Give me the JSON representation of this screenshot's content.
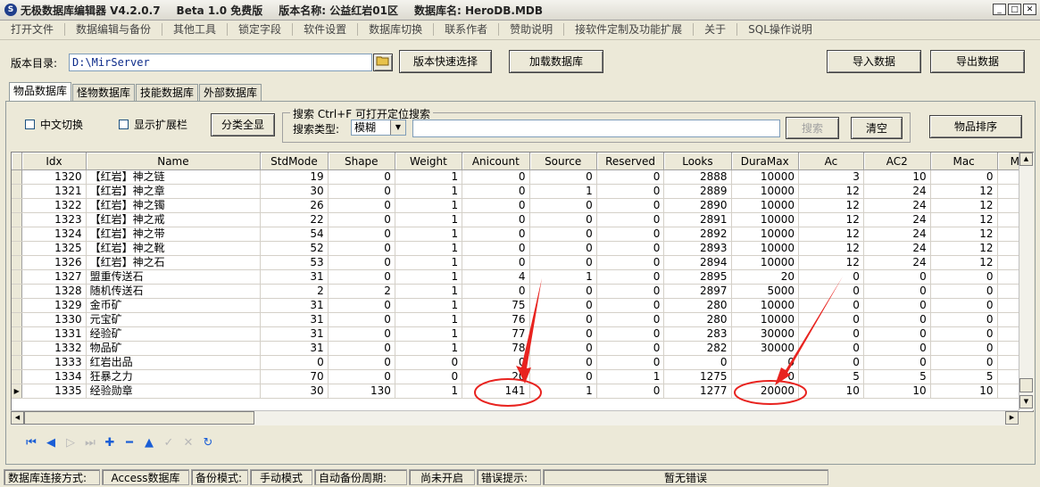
{
  "titlebar": {
    "app_name": "无极数据库编辑器 V4.2.0.7",
    "edition": "Beta 1.0 免费版",
    "version_name": "版本名称: 公益红岩01区",
    "db_name": "数据库名: HeroDB.MDB"
  },
  "menu": [
    "打开文件",
    "数据编辑与备份",
    "其他工具",
    "锁定字段",
    "软件设置",
    "数据库切换",
    "联系作者",
    "赞助说明",
    "接软件定制及功能扩展",
    "关于",
    "SQL操作说明"
  ],
  "toolbar": {
    "dir_label": "版本目录:",
    "dir_value": "D:\\MirServer",
    "quick_select": "版本快速选择",
    "load_db": "加载数据库",
    "import": "导入数据",
    "export": "导出数据"
  },
  "tabs": [
    "物品数据库",
    "怪物数据库",
    "技能数据库",
    "外部数据库"
  ],
  "filters": {
    "chinese_toggle": "中文切换",
    "show_extension": "显示扩展栏",
    "show_all_categories": "分类全显",
    "search_group_title": "搜索  Ctrl+F 可打开定位搜索",
    "search_type_label": "搜索类型:",
    "search_type_value": "模糊",
    "search_button": "搜索",
    "clear_button": "清空",
    "sort_button": "物品排序"
  },
  "grid": {
    "columns": [
      "Idx",
      "Name",
      "StdMode",
      "Shape",
      "Weight",
      "Anicount",
      "Source",
      "Reserved",
      "Looks",
      "DuraMax",
      "Ac",
      "AC2",
      "Mac",
      "M"
    ],
    "rows": [
      [
        "1320",
        "【红岩】神之链",
        "19",
        "0",
        "1",
        "0",
        "0",
        "0",
        "2888",
        "10000",
        "3",
        "10",
        "0"
      ],
      [
        "1321",
        "【红岩】神之章",
        "30",
        "0",
        "1",
        "0",
        "1",
        "0",
        "2889",
        "10000",
        "12",
        "24",
        "12"
      ],
      [
        "1322",
        "【红岩】神之镯",
        "26",
        "0",
        "1",
        "0",
        "0",
        "0",
        "2890",
        "10000",
        "12",
        "24",
        "12"
      ],
      [
        "1323",
        "【红岩】神之戒",
        "22",
        "0",
        "1",
        "0",
        "0",
        "0",
        "2891",
        "10000",
        "12",
        "24",
        "12"
      ],
      [
        "1324",
        "【红岩】神之带",
        "54",
        "0",
        "1",
        "0",
        "0",
        "0",
        "2892",
        "10000",
        "12",
        "24",
        "12"
      ],
      [
        "1325",
        "【红岩】神之靴",
        "52",
        "0",
        "1",
        "0",
        "0",
        "0",
        "2893",
        "10000",
        "12",
        "24",
        "12"
      ],
      [
        "1326",
        "【红岩】神之石",
        "53",
        "0",
        "1",
        "0",
        "0",
        "0",
        "2894",
        "10000",
        "12",
        "24",
        "12"
      ],
      [
        "1327",
        "盟重传送石",
        "31",
        "0",
        "1",
        "4",
        "1",
        "0",
        "2895",
        "20",
        "0",
        "0",
        "0"
      ],
      [
        "1328",
        "随机传送石",
        "2",
        "2",
        "1",
        "0",
        "0",
        "0",
        "2897",
        "5000",
        "0",
        "0",
        "0"
      ],
      [
        "1329",
        "金币矿",
        "31",
        "0",
        "1",
        "75",
        "0",
        "0",
        "280",
        "10000",
        "0",
        "0",
        "0"
      ],
      [
        "1330",
        "元宝矿",
        "31",
        "0",
        "1",
        "76",
        "0",
        "0",
        "280",
        "10000",
        "0",
        "0",
        "0"
      ],
      [
        "1331",
        "经验矿",
        "31",
        "0",
        "1",
        "77",
        "0",
        "0",
        "283",
        "30000",
        "0",
        "0",
        "0"
      ],
      [
        "1332",
        "物品矿",
        "31",
        "0",
        "1",
        "78",
        "0",
        "0",
        "282",
        "30000",
        "0",
        "0",
        "0"
      ],
      [
        "1333",
        "红岩出品",
        "0",
        "0",
        "0",
        "0",
        "0",
        "0",
        "0",
        "0",
        "0",
        "0",
        "0"
      ],
      [
        "1334",
        "狂暴之力",
        "70",
        "0",
        "0",
        "20",
        "0",
        "1",
        "1275",
        "0",
        "5",
        "5",
        "5"
      ],
      [
        "1335",
        "经验勋章",
        "30",
        "130",
        "1",
        "141",
        "1",
        "0",
        "1277",
        "20000",
        "10",
        "10",
        "10"
      ]
    ],
    "current_row_index": 15
  },
  "nav_icons": [
    "first-icon",
    "prior-icon",
    "next-icon",
    "last-icon",
    "insert-icon",
    "delete-icon",
    "edit-icon",
    "post-icon",
    "cancel-icon",
    "refresh-icon"
  ],
  "status": {
    "conn_label": "数据库连接方式:",
    "conn_value": "Access数据库",
    "backup_label": "备份模式:",
    "backup_value": "手动模式",
    "auto_backup_label": "自动备份周期:",
    "auto_backup_value": "尚未开启",
    "error_label": "错误提示:",
    "error_value": "暂无错误"
  },
  "colors": {
    "annotation": "#e8231f",
    "link_blue": "#0b2a8a"
  }
}
